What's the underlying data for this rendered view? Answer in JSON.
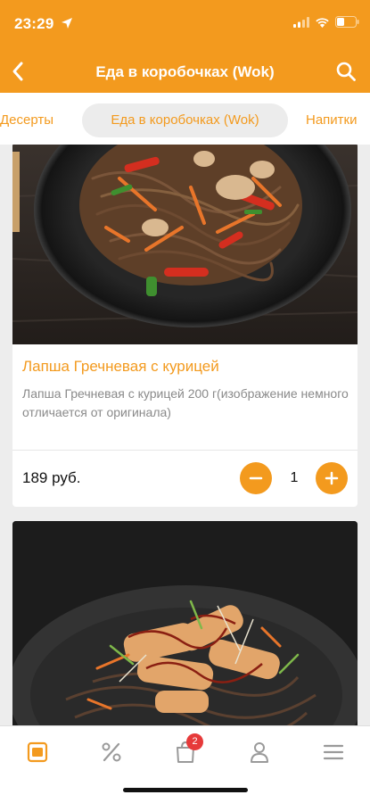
{
  "status_bar": {
    "time": "23:29"
  },
  "header": {
    "title": "Еда в коробочках (Wok)",
    "back_icon": "chevron-left-icon",
    "search_icon": "search-icon"
  },
  "tabs": [
    {
      "label": "Десерты"
    },
    {
      "label": "Еда в коробочках (Wok)",
      "selected": true
    },
    {
      "label": "Напитки"
    }
  ],
  "products": [
    {
      "name": "Лапша Гречневая с курицей",
      "description": "Лапша Гречневая с курицей 200 г(изображение немного отличается от оригинала)",
      "price": "189 руб.",
      "quantity": "1"
    },
    {
      "image": "wok-noodles-with-chicken-teriyaki"
    }
  ],
  "bottom_nav": {
    "items": [
      {
        "icon": "menu-card-icon",
        "active": true
      },
      {
        "icon": "percent-icon"
      },
      {
        "icon": "cart-icon",
        "badge": "2"
      },
      {
        "icon": "profile-icon"
      },
      {
        "icon": "hamburger-menu-icon"
      }
    ]
  },
  "colors": {
    "accent": "#f39a1e",
    "badge": "#e63a3a",
    "background": "#ededed"
  }
}
